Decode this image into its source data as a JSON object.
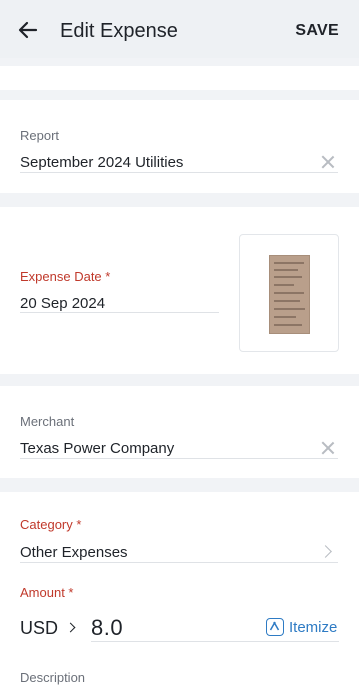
{
  "header": {
    "title": "Edit Expense",
    "save_label": "SAVE"
  },
  "report": {
    "label": "Report",
    "value": "September 2024 Utilities"
  },
  "expense_date": {
    "label": "Expense Date *",
    "value": "20 Sep 2024"
  },
  "merchant": {
    "label": "Merchant",
    "value": "Texas Power Company"
  },
  "category": {
    "label": "Category *",
    "value": "Other Expenses"
  },
  "amount": {
    "label": "Amount *",
    "currency": "USD",
    "value": "8.0",
    "itemize_label": "Itemize"
  },
  "description": {
    "label": "Description"
  },
  "colors": {
    "accent": "#2e7bc4",
    "required": "#c0392b",
    "background": "#f1f3f6"
  },
  "icons": {
    "back": "arrow-left-icon",
    "clear": "close-icon",
    "chevron": "chevron-right-icon",
    "itemize": "itemize-icon",
    "receipt": "receipt-thumbnail"
  }
}
